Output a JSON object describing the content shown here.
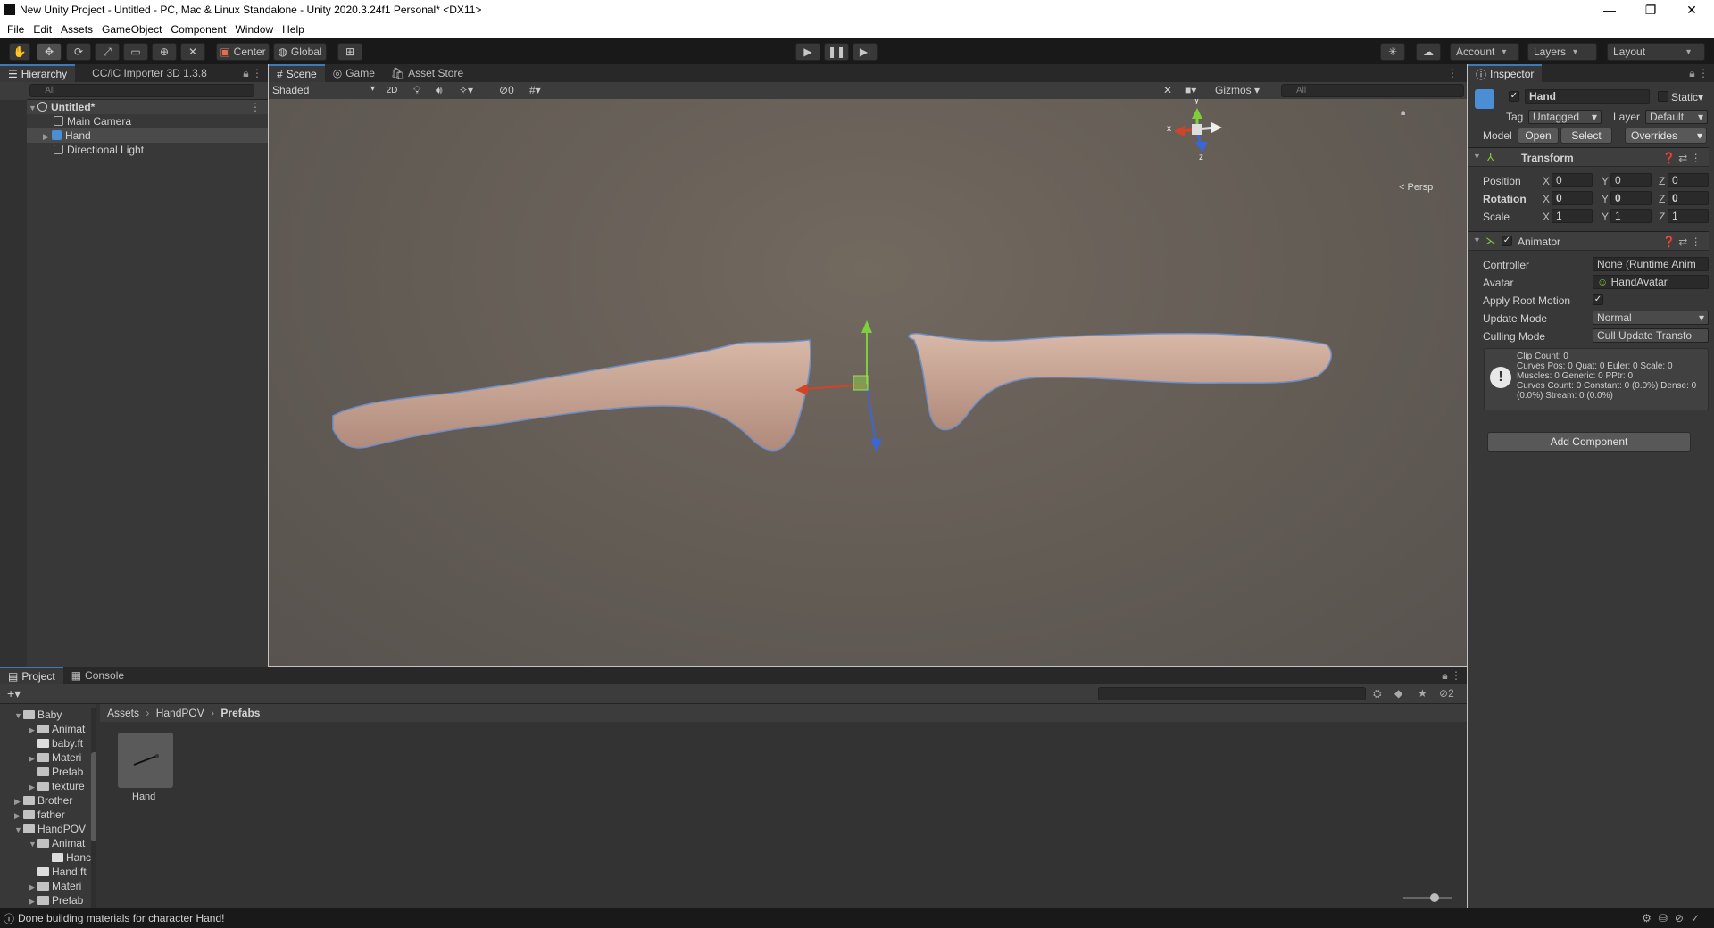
{
  "window": {
    "title": "New Unity Project - Untitled - PC, Mac & Linux Standalone - Unity 2020.3.24f1 Personal* <DX11>",
    "controls": {
      "minimize": "—",
      "restore": "❐",
      "close": "✕"
    }
  },
  "menu": [
    "File",
    "Edit",
    "Assets",
    "GameObject",
    "Component",
    "Window",
    "Help"
  ],
  "toolbar": {
    "tools": [
      "hand-tool-icon",
      "move-tool-icon",
      "rotate-tool-icon",
      "scale-tool-icon",
      "rect-tool-icon",
      "transform-tool-icon",
      "custom-tool-icon"
    ],
    "pivot": "Center",
    "space": "Global",
    "account": "Account",
    "layers": "Layers",
    "layout": "Layout"
  },
  "hierarchy": {
    "tab": "Hierarchy",
    "tab2": "CC/iC Importer 3D 1.3.8",
    "search_placeholder": "All",
    "scene": "Untitled*",
    "items": [
      "Main Camera",
      "Hand",
      "Directional Light"
    ]
  },
  "scene": {
    "tabs": [
      "Scene",
      "Game",
      "Asset Store"
    ],
    "shading": "Shaded",
    "mode2d": "2D",
    "hidden_count": "0",
    "gizmos": "Gizmos",
    "search_placeholder": "All",
    "persp": "< Persp",
    "axes": {
      "x": "x",
      "y": "y",
      "z": "z"
    }
  },
  "inspector": {
    "tab": "Inspector",
    "object_name": "Hand",
    "static": "Static",
    "tag_label": "Tag",
    "tag": "Untagged",
    "layer_label": "Layer",
    "layer": "Default",
    "model_label": "Model",
    "open": "Open",
    "select": "Select",
    "overrides": "Overrides",
    "transform": {
      "title": "Transform",
      "position_label": "Position",
      "position": [
        "0",
        "0",
        "0"
      ],
      "rotation_label": "Rotation",
      "rotation": [
        "0",
        "0",
        "0"
      ],
      "scale_label": "Scale",
      "scale": [
        "1",
        "1",
        "1"
      ]
    },
    "animator": {
      "title": "Animator",
      "controller_label": "Controller",
      "controller": "None (Runtime Anim",
      "avatar_label": "Avatar",
      "avatar": "HandAvatar",
      "root_motion_label": "Apply Root Motion",
      "update_mode_label": "Update Mode",
      "update_mode": "Normal",
      "culling_mode_label": "Culling Mode",
      "culling_mode": "Cull Update Transfo",
      "info": "Clip Count: 0\nCurves Pos: 0 Quat: 0 Euler: 0 Scale: 0\nMuscles: 0 Generic: 0 PPtr: 0\nCurves Count: 0 Constant: 0 (0.0%) Dense: 0 (0.0%) Stream: 0 (0.0%)"
    },
    "add_component": "Add Component"
  },
  "project": {
    "tabs": [
      "Project",
      "Console"
    ],
    "hidden_count": "2",
    "breadcrumb": [
      "Assets",
      "HandPOV",
      "Prefabs"
    ],
    "tree": [
      {
        "label": "Baby",
        "indent": 1,
        "open": true
      },
      {
        "label": "Animat",
        "indent": 2,
        "open": false
      },
      {
        "label": "baby.ft",
        "indent": 2,
        "open": null
      },
      {
        "label": "Materi",
        "indent": 2,
        "open": false
      },
      {
        "label": "Prefab",
        "indent": 2,
        "open": null
      },
      {
        "label": "texture",
        "indent": 2,
        "open": false
      },
      {
        "label": "Brother",
        "indent": 1,
        "open": false
      },
      {
        "label": "father",
        "indent": 1,
        "open": false
      },
      {
        "label": "HandPOV",
        "indent": 1,
        "open": true
      },
      {
        "label": "Animat",
        "indent": 2,
        "open": true
      },
      {
        "label": "Hanc",
        "indent": 3,
        "open": null
      },
      {
        "label": "Hand.ft",
        "indent": 2,
        "open": null
      },
      {
        "label": "Materi",
        "indent": 2,
        "open": false
      },
      {
        "label": "Prefab",
        "indent": 2,
        "open": false
      }
    ],
    "asset": "Hand"
  },
  "status": "Done building materials for character Hand!"
}
